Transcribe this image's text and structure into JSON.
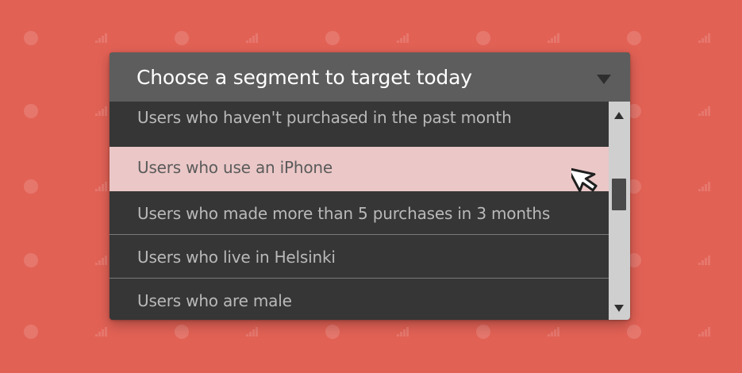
{
  "dropdown": {
    "title": "Choose a segment to target today",
    "selected_index": 1,
    "options": [
      {
        "label": "Users who haven't purchased in the past month"
      },
      {
        "label": "Users who use an iPhone"
      },
      {
        "label": "Users who made more than 5 purchases in 3 months"
      },
      {
        "label": "Users who live in Helsinki"
      },
      {
        "label": "Users who are male"
      }
    ]
  },
  "icons": {
    "dropdown_arrow": "chevron-down-icon",
    "scroll_up": "scroll-up-arrow-icon",
    "scroll_down": "scroll-down-arrow-icon",
    "cursor": "mouse-pointer-icon",
    "background_dot": "dot-icon",
    "background_signal": "signal-bars-icon"
  },
  "colors": {
    "background": "#e26155",
    "header": "#5d5d5d",
    "option_bg": "#363636",
    "option_text": "#b9b9b9",
    "selected_bg": "#ebc7c7",
    "selected_text": "#5b5b5b",
    "scrollbar_track": "#cfcfcf",
    "scrollbar_thumb": "#4a4a4a"
  }
}
